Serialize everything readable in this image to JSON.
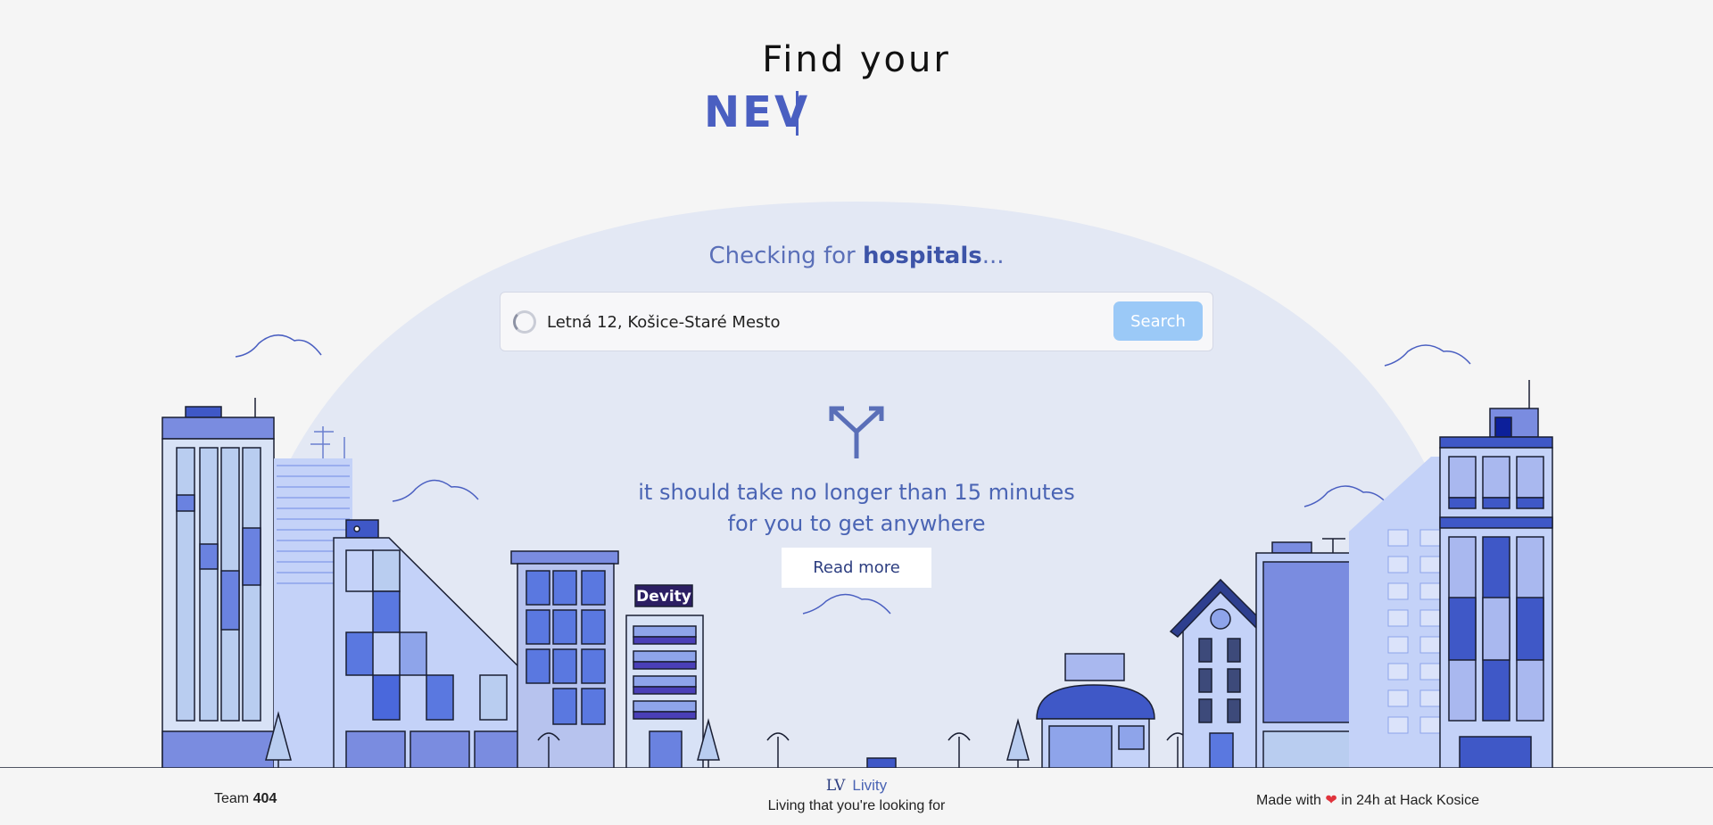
{
  "hero": {
    "title": "Find your",
    "typed_word": "NEV"
  },
  "status": {
    "prefix": "Checking for ",
    "keyword": "hospitals",
    "suffix": "..."
  },
  "search": {
    "value": "Letná 12, Košice-Staré Mesto",
    "button_label": "Search"
  },
  "tagline": {
    "line1": "it should take no longer than 15 minutes",
    "line2": "for you to get anywhere"
  },
  "read_more_label": "Read more",
  "sign_text": "Devity",
  "footer": {
    "team_prefix": "Team ",
    "team_number": "404",
    "brand_logo": "LV",
    "brand_name": "Livity",
    "brand_subtitle": "Living that you're looking for",
    "made_prefix": "Made with ",
    "heart": "❤",
    "made_suffix": " in 24h at Hack Kosice"
  },
  "colors": {
    "accent": "#4a5fc1",
    "button": "#9bc9f7",
    "dome": "#e3e8f4",
    "building_light": "#b9cdf0",
    "building_mid": "#7a8ce0"
  }
}
